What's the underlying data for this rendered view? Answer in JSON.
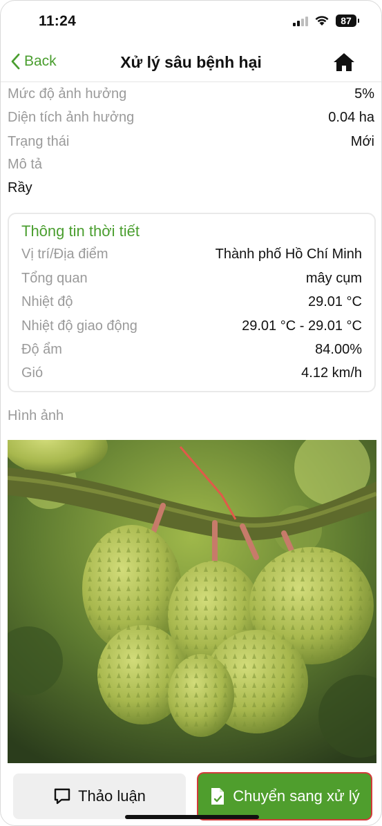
{
  "status": {
    "time": "11:24",
    "battery": "87"
  },
  "nav": {
    "back_label": "Back",
    "title": "Xử lý sâu bệnh hại"
  },
  "details": [
    {
      "label": "Mức độ ảnh hưởng",
      "value": "5%"
    },
    {
      "label": "Diện tích ảnh hưởng",
      "value": "0.04 ha"
    },
    {
      "label": "Trạng thái",
      "value": "Mới"
    }
  ],
  "description": {
    "label": "Mô tả",
    "value": "Rầy"
  },
  "weather": {
    "title": "Thông tin thời tiết",
    "rows": [
      {
        "label": "Vị trí/Địa điểm",
        "value": "Thành phố Hồ Chí Minh"
      },
      {
        "label": "Tổng quan",
        "value": "mây cụm"
      },
      {
        "label": "Nhiệt độ",
        "value": "29.01 °C"
      },
      {
        "label": "Nhiệt độ giao động",
        "value": "29.01 °C - 29.01 °C"
      },
      {
        "label": "Độ ẩm",
        "value": "84.00%"
      },
      {
        "label": "Gió",
        "value": "4.12 km/h"
      }
    ]
  },
  "images": {
    "label": "Hình ảnh"
  },
  "actions": {
    "discuss_label": "Thảo luận",
    "process_label": "Chuyển sang xử lý"
  },
  "colors": {
    "accent": "#4a9e2f",
    "process_button": "#4f9e2d",
    "highlight_border": "#d23a3a"
  }
}
